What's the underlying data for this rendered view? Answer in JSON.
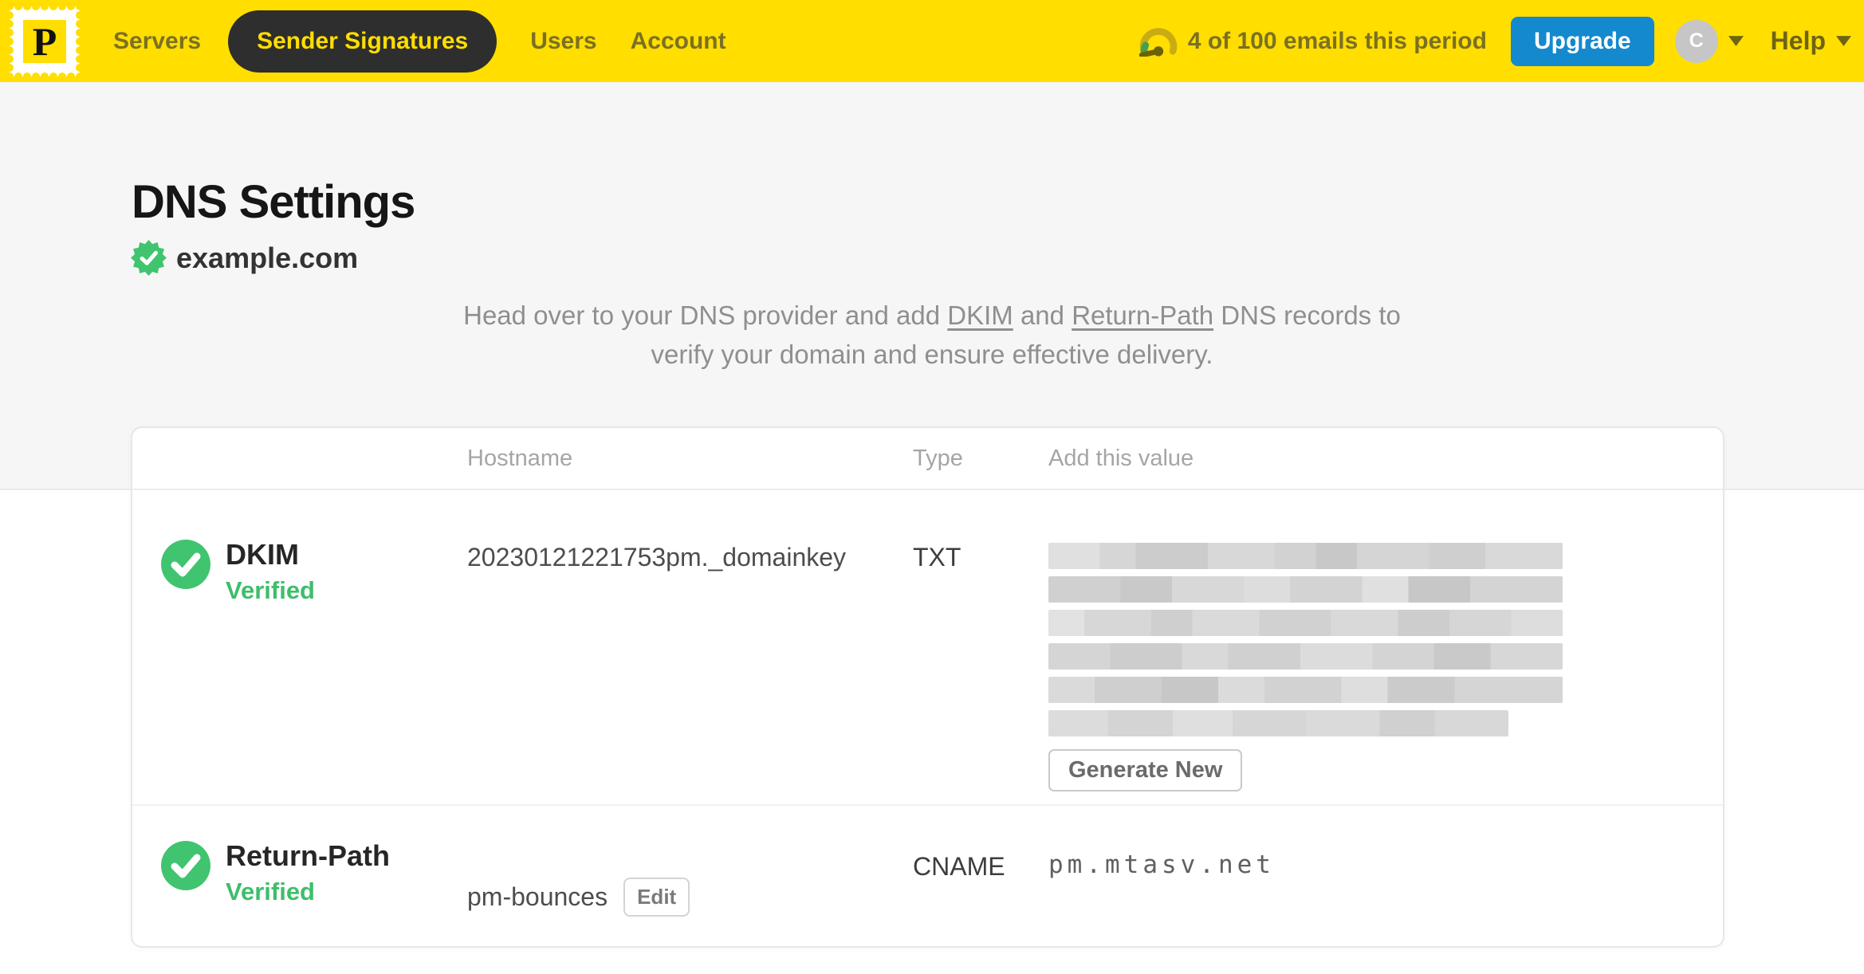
{
  "brand": {
    "logo_letter": "P"
  },
  "nav": {
    "items": [
      {
        "label": "Servers",
        "active": false
      },
      {
        "label": "Sender Signatures",
        "active": true
      },
      {
        "label": "Users",
        "active": false
      },
      {
        "label": "Account",
        "active": false
      }
    ],
    "usage_text": "4 of 100 emails this period",
    "upgrade_label": "Upgrade",
    "avatar_initial": "C",
    "help_label": "Help"
  },
  "page": {
    "title": "DNS Settings",
    "domain": "example.com",
    "intro": {
      "lead": "Head over to your DNS provider and add ",
      "dkim_link": "DKIM",
      "between": " and ",
      "return_path_link": "Return-Path",
      "tail_line1": " DNS records to",
      "tail_line2": "verify your domain and ensure effective delivery."
    }
  },
  "table": {
    "headers": {
      "hostname": "Hostname",
      "type": "Type",
      "value": "Add this value"
    },
    "dkim_row": {
      "name": "DKIM",
      "status": "Verified",
      "hostname": "20230121221753pm._domainkey",
      "type": "TXT",
      "value_redacted": true,
      "action_label": "Generate New"
    },
    "return_path_row": {
      "name": "Return-Path",
      "status": "Verified",
      "hostname": "pm-bounces",
      "edit_label": "Edit",
      "type": "CNAME",
      "value": "pm.mtasv.net"
    }
  },
  "colors": {
    "brand_yellow": "#FFDE00",
    "nav_text_olive": "#7B7022",
    "nav_active_bg": "#2E2E2E",
    "upgrade_blue": "#1489CE",
    "verified_green": "#41C46F",
    "avatar_gray": "#C6C6C6"
  }
}
